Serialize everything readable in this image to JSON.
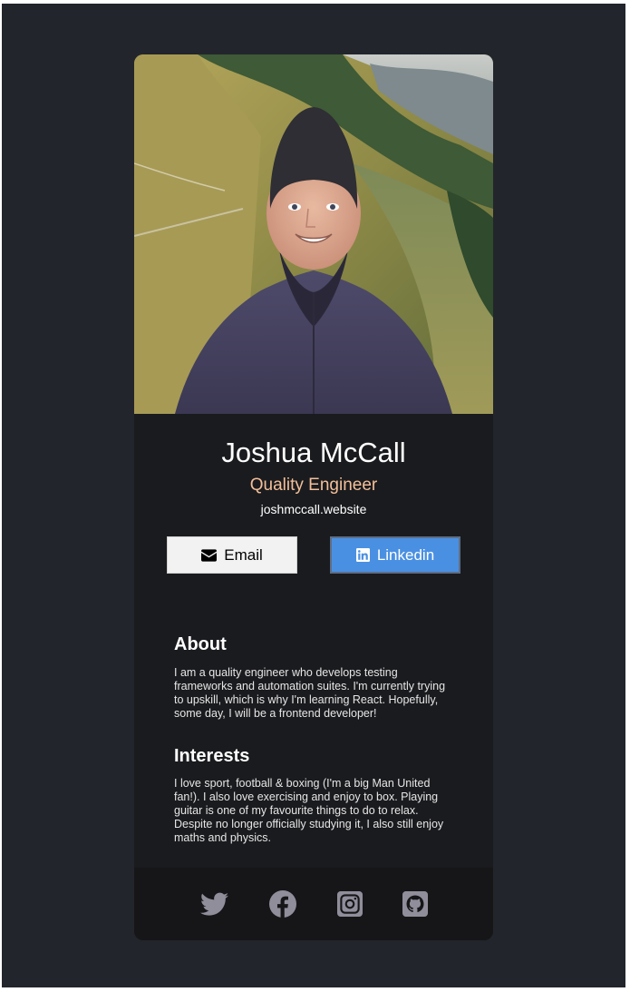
{
  "profile": {
    "name": "Joshua McCall",
    "role": "Quality Engineer",
    "website": "joshmccall.website",
    "photo_alt": "Joshua McCall"
  },
  "buttons": {
    "email_label": "Email",
    "linkedin_label": "Linkedin"
  },
  "about": {
    "title": "About",
    "text": "I am a quality engineer who develops testing frameworks and automation suites. I'm currently trying to upskill, which is why I'm learning React. Hopefully, some day, I will be a frontend developer!"
  },
  "interests": {
    "title": "Interests",
    "text": "I love sport, football & boxing (I'm a big Man United fan!). I also love exercising and enjoy to box. Playing guitar is one of my favourite things to do to relax. Despite no longer officially studying it, I also still enjoy maths and physics."
  },
  "social_icons": [
    "twitter-icon",
    "facebook-icon",
    "instagram-icon",
    "github-icon"
  ],
  "colors": {
    "page_background": "#23252c",
    "card_background": "#1a1b1e",
    "footer_background": "#161618",
    "role_accent": "#f3bf99",
    "linkedin_blue": "#4a90e2",
    "icon_gray": "#918e9b"
  }
}
